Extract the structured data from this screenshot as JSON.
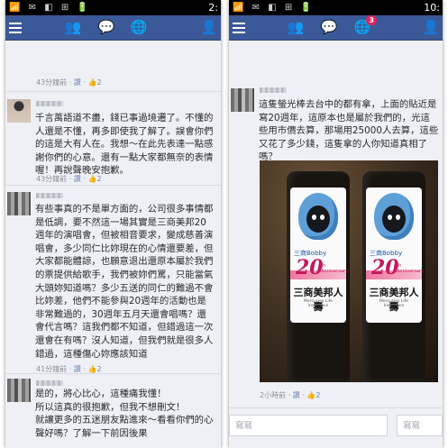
{
  "left_panel": {
    "clock": "2:",
    "status_icons": "📶 ✉ ◧ ⊞ 🔋",
    "toolbar": {
      "menu_icon": "menu-icon",
      "friends_icon": "friends-icon",
      "messages_icon": "messages-icon",
      "globe_icon": "globe-icon",
      "person_icon": "person-icon"
    },
    "top_meta": {
      "time": "43分鐘前",
      "like": "讚",
      "likes": "2"
    },
    "comments": [
      {
        "text": "千言萬語道不盡，錢已事過境遷了。不懂的人還是不懂，再多即使我了解了。誤會你們的這是大有人在。我想～在此先表達一點感謝你們的心意。還有一點大家都無奈的表情喔！再說聲晚安抱歉。",
        "time": "43分鐘前",
        "like": "讚",
        "likes": "2"
      },
      {
        "text": "有些事真的不是單方面的，公司很多事情都是低調，要不然這一場其實是三商美邦20週年的演唱會，但被相音要求，變成慈善演唱會，多少同仁比妳現在的心情還要差，但大家都能體諒，也願意退出還原本屬於我們的票提供給歌手，我們被妳們罵，只能當氣大頭妳知道嗎？多少五送的同仁的難過不會比妳差，他們不能參與20週年的活動也是非常難過的，30週年五月天還會唱嗎？還會代言嗎？這我們都不知道，但錯過這一次還會在有嗎？沒人知道，但我們就是很多人錯過，這種傷心妳應該知道",
        "time": "41分鐘前",
        "like": "讚",
        "likes": "2"
      },
      {
        "text": "是的，將心比心，這種痛我懂！\n所以這真的很抱歉，但我不想刪文！\n就讓更多的五迷朋友點進來～看看你們的心聲好嗎？了解一下前因後果",
        "time": "",
        "like": "",
        "likes": ""
      }
    ]
  },
  "right_panel": {
    "clock": "10:",
    "status_icons": "📶 ✉ ◧ ⊞ 🔋",
    "toolbar": {
      "menu_icon": "menu-icon",
      "friends_icon": "friends-icon",
      "messages_icon": "messages-icon",
      "globe_icon": "globe-icon",
      "notification_count": "3",
      "person_icon": "person-icon"
    },
    "comment": {
      "text": "這隻螢光棒去台中的都有拿，上面的貼近是寫20週年，這原本也是屬於我們的，光這些用市價去算，那場用25000人去算，這些又花了多少錢，這隻拿的人你知道真相了嗎？",
      "time": "2小時前",
      "like": "讚",
      "likes": "2"
    },
    "photo": {
      "brand_small": "三商Bobby",
      "anniversary": "20",
      "anniversary_sub": "th Anniversary",
      "company": "三商美邦人壽",
      "company_en": "Mercuries Life Insurance"
    },
    "reply_placeholder": "寫寫"
  }
}
